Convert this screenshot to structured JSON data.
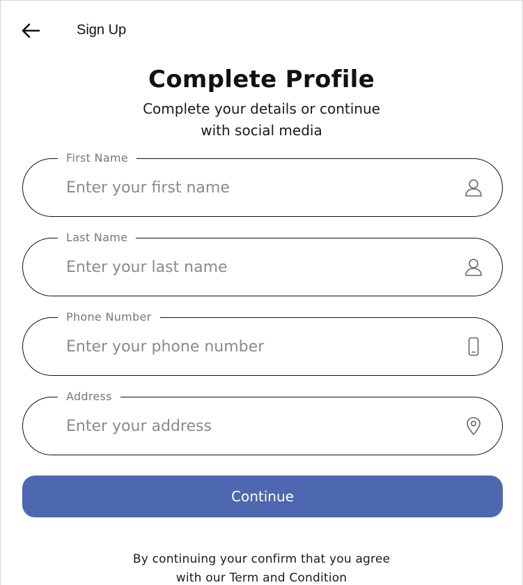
{
  "appbar": {
    "title": "Sign Up",
    "back_icon": "arrow-left-icon"
  },
  "header": {
    "title": "Complete Profile",
    "subtitle_line1": "Complete your details or continue",
    "subtitle_line2": "with social media"
  },
  "form": {
    "first_name": {
      "label": "First Name",
      "placeholder": "Enter your first name",
      "value": "",
      "icon": "user-icon"
    },
    "last_name": {
      "label": "Last Name",
      "placeholder": "Enter your last name",
      "value": "",
      "icon": "user-icon"
    },
    "phone": {
      "label": "Phone Number",
      "placeholder": "Enter your phone number",
      "value": "",
      "icon": "phone-icon"
    },
    "address": {
      "label": "Address",
      "placeholder": "Enter your address",
      "value": "",
      "icon": "location-pin-icon"
    }
  },
  "continue_label": "Continue",
  "footer": {
    "terms_line1": "By continuing your confirm that you agree",
    "terms_line2": "with our Term and Condition"
  },
  "colors": {
    "primary": "#4d68b1",
    "border": "#111111",
    "label": "#777777",
    "placeholder": "#8a8a8a"
  }
}
